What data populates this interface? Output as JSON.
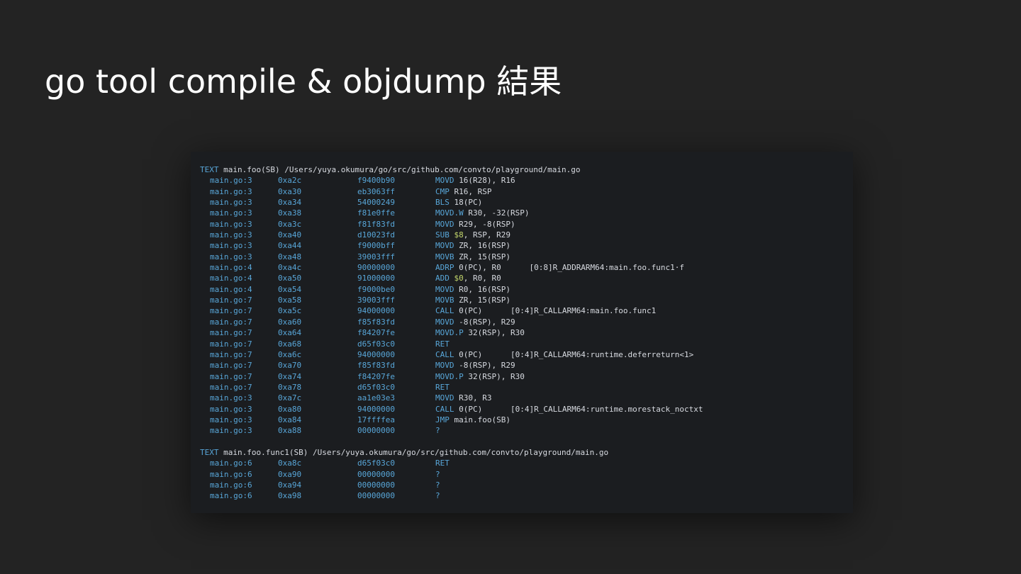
{
  "title": "go tool compile & objdump 結果",
  "colors": {
    "background": "#232323",
    "panel": "#1b1d20",
    "keyword": "#58a6d8",
    "text": "#d7dae0",
    "immediate": "#c3d66b"
  },
  "sections": [
    {
      "keyword": "TEXT",
      "header": "main.foo(SB) /Users/yuya.okumura/go/src/github.com/convto/playground/main.go",
      "rows": [
        {
          "file": "main.go:3",
          "addr": "0xa2c",
          "hex": "f9400b90",
          "op": "MOVD",
          "args": "16(R28), R16"
        },
        {
          "file": "main.go:3",
          "addr": "0xa30",
          "hex": "eb3063ff",
          "op": "CMP",
          "args": "R16, RSP"
        },
        {
          "file": "main.go:3",
          "addr": "0xa34",
          "hex": "54000249",
          "op": "BLS",
          "args": "18(PC)"
        },
        {
          "file": "main.go:3",
          "addr": "0xa38",
          "hex": "f81e0ffe",
          "op": "MOVD.W",
          "args": "R30, -32(RSP)"
        },
        {
          "file": "main.go:3",
          "addr": "0xa3c",
          "hex": "f81f83fd",
          "op": "MOVD",
          "args": "R29, -8(RSP)"
        },
        {
          "file": "main.go:3",
          "addr": "0xa40",
          "hex": "d10023fd",
          "op": "SUB",
          "imm": "$8",
          "args": ", RSP, R29"
        },
        {
          "file": "main.go:3",
          "addr": "0xa44",
          "hex": "f9000bff",
          "op": "MOVD",
          "args": "ZR, 16(RSP)"
        },
        {
          "file": "main.go:3",
          "addr": "0xa48",
          "hex": "39003fff",
          "op": "MOVB",
          "args": "ZR, 15(RSP)"
        },
        {
          "file": "main.go:4",
          "addr": "0xa4c",
          "hex": "90000000",
          "op": "ADRP",
          "args": "0(PC), R0      [0:8]R_ADDRARM64:main.foo.func1·f"
        },
        {
          "file": "main.go:4",
          "addr": "0xa50",
          "hex": "91000000",
          "op": "ADD",
          "imm": "$0",
          "args": ", R0, R0"
        },
        {
          "file": "main.go:4",
          "addr": "0xa54",
          "hex": "f9000be0",
          "op": "MOVD",
          "args": "R0, 16(RSP)"
        },
        {
          "file": "main.go:7",
          "addr": "0xa58",
          "hex": "39003fff",
          "op": "MOVB",
          "args": "ZR, 15(RSP)"
        },
        {
          "file": "main.go:7",
          "addr": "0xa5c",
          "hex": "94000000",
          "op": "CALL",
          "args": "0(PC)      [0:4]R_CALLARM64:main.foo.func1"
        },
        {
          "file": "main.go:7",
          "addr": "0xa60",
          "hex": "f85f83fd",
          "op": "MOVD",
          "args": "-8(RSP), R29"
        },
        {
          "file": "main.go:7",
          "addr": "0xa64",
          "hex": "f84207fe",
          "op": "MOVD.P",
          "args": "32(RSP), R30"
        },
        {
          "file": "main.go:7",
          "addr": "0xa68",
          "hex": "d65f03c0",
          "op": "RET",
          "args": ""
        },
        {
          "file": "main.go:7",
          "addr": "0xa6c",
          "hex": "94000000",
          "op": "CALL",
          "args": "0(PC)      [0:4]R_CALLARM64:runtime.deferreturn<1>"
        },
        {
          "file": "main.go:7",
          "addr": "0xa70",
          "hex": "f85f83fd",
          "op": "MOVD",
          "args": "-8(RSP), R29"
        },
        {
          "file": "main.go:7",
          "addr": "0xa74",
          "hex": "f84207fe",
          "op": "MOVD.P",
          "args": "32(RSP), R30"
        },
        {
          "file": "main.go:7",
          "addr": "0xa78",
          "hex": "d65f03c0",
          "op": "RET",
          "args": ""
        },
        {
          "file": "main.go:3",
          "addr": "0xa7c",
          "hex": "aa1e03e3",
          "op": "MOVD",
          "args": "R30, R3"
        },
        {
          "file": "main.go:3",
          "addr": "0xa80",
          "hex": "94000000",
          "op": "CALL",
          "args": "0(PC)      [0:4]R_CALLARM64:runtime.morestack_noctxt"
        },
        {
          "file": "main.go:3",
          "addr": "0xa84",
          "hex": "17ffffea",
          "op": "JMP",
          "args": "main.foo(SB)"
        },
        {
          "file": "main.go:3",
          "addr": "0xa88",
          "hex": "00000000",
          "op": "?",
          "args": ""
        }
      ]
    },
    {
      "keyword": "TEXT",
      "header": "main.foo.func1(SB) /Users/yuya.okumura/go/src/github.com/convto/playground/main.go",
      "rows": [
        {
          "file": "main.go:6",
          "addr": "0xa8c",
          "hex": "d65f03c0",
          "op": "RET",
          "args": ""
        },
        {
          "file": "main.go:6",
          "addr": "0xa90",
          "hex": "00000000",
          "op": "?",
          "args": ""
        },
        {
          "file": "main.go:6",
          "addr": "0xa94",
          "hex": "00000000",
          "op": "?",
          "args": ""
        },
        {
          "file": "main.go:6",
          "addr": "0xa98",
          "hex": "00000000",
          "op": "?",
          "args": ""
        }
      ]
    }
  ]
}
